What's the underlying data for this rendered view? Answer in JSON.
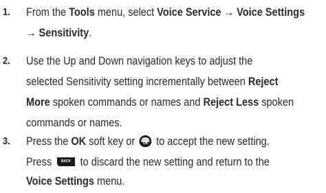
{
  "steps": [
    {
      "number": "1.",
      "lines": [
        {
          "p1": "From the ",
          "b1": "Tools",
          "p2": " menu, select ",
          "b2": "Voice Service → Voice Settings"
        },
        {
          "b1": "→ Sensitivity",
          "p1": "."
        }
      ]
    },
    {
      "number": "2.",
      "lines": [
        {
          "p1": "Use the Up and Down navigation keys to adjust the"
        },
        {
          "p1": "selected Sensitivity setting incrementally between ",
          "b1": "Reject"
        },
        {
          "b1": "More",
          "p1": " spoken commands or names and ",
          "b2": "Reject Less",
          "p2": " spoken"
        },
        {
          "p1": "commands or names."
        }
      ]
    },
    {
      "number": "3.",
      "lines": [
        {
          "p1": "Press the ",
          "b1": "OK",
          "p2": " soft key or ",
          "p3": " to accept the new setting."
        },
        {
          "p1": "Press ",
          "p2": " to discard the new setting and return to the"
        },
        {
          "b1": "Voice Settings",
          "p1": " menu."
        }
      ]
    }
  ],
  "icons": {
    "ok_key_text": "OK",
    "back_key_text": "BACK"
  }
}
